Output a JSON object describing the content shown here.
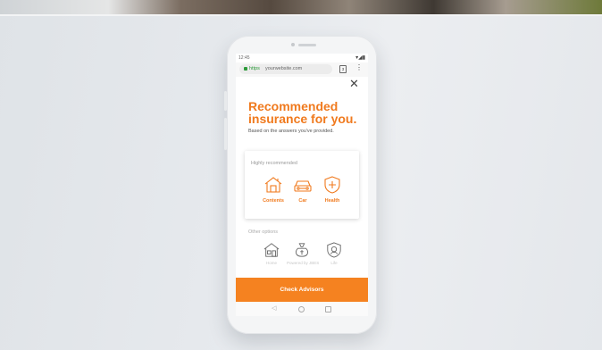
{
  "status": {
    "time": "12:45"
  },
  "browser": {
    "protocol": "https",
    "host": "yourwebsite.com",
    "tabs_count": "3"
  },
  "page": {
    "title_line1": "Recommended",
    "title_line2": "insurance for you.",
    "subtitle": "Based on the answers you've provided."
  },
  "recommended": {
    "label": "Highly recommended",
    "items": [
      {
        "label": "Contents",
        "icon": "house-icon"
      },
      {
        "label": "Car",
        "icon": "car-icon"
      },
      {
        "label": "Health",
        "icon": "health-shield-icon"
      }
    ]
  },
  "other": {
    "label": "Other options",
    "items": [
      {
        "label": "Home",
        "icon": "house-icon"
      },
      {
        "label": "Powered by JBES",
        "icon": "money-bag-icon"
      },
      {
        "label": "Life",
        "icon": "life-shield-icon"
      }
    ]
  },
  "cta": {
    "label": "Check Advisors"
  },
  "colors": {
    "accent": "#f58220",
    "title": "#f07a1e"
  }
}
